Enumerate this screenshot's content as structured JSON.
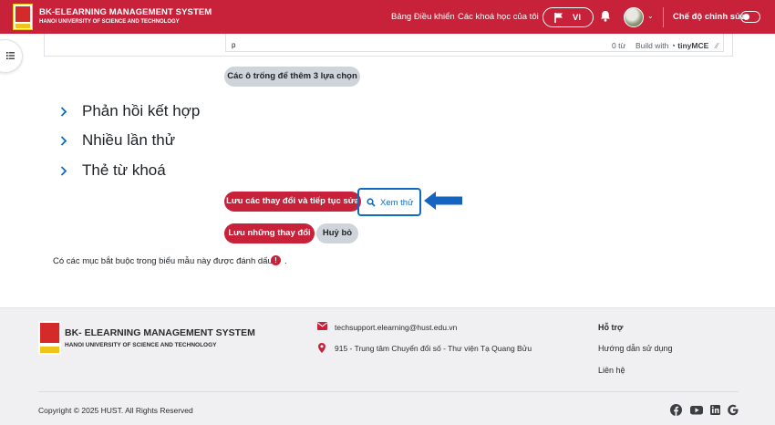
{
  "header": {
    "brand_title": "BK-ELEARNING MANAGEMENT SYSTEM",
    "brand_subtitle": "HANOI UNIVERSITY OF SCIENCE AND TECHNOLOGY",
    "nav_dashboard": "Bảng Điều khiển",
    "nav_my_courses": "Các khoá học của tôi",
    "language": "VI",
    "edit_mode_label": "Chế độ chỉnh sửa",
    "edit_mode_on": false
  },
  "editor": {
    "path": "p",
    "word_count": "0 từ",
    "build_with": "Build with",
    "tinymce": "tinyMCE"
  },
  "form": {
    "add_choices_button": "Các ô trống để thêm 3 lựa chọn",
    "sections": [
      {
        "title": "Phản hồi kết hợp"
      },
      {
        "title": "Nhiều lần thử"
      },
      {
        "title": "Thẻ từ khoá"
      }
    ],
    "save_continue_button": "Lưu các thay đổi và tiếp tục sửa",
    "preview_button": "Xem thử",
    "save_button": "Lưu những thay đổi",
    "cancel_button": "Huỷ bỏ",
    "required_note": "Có các mục bắt buộc trong biểu mẫu này được đánh dấu",
    "required_icon": "!",
    "required_period": "."
  },
  "footer": {
    "brand_title": "BK- ELEARNING MANAGEMENT SYSTEM",
    "brand_subtitle": "HANOI UNIVERSITY OF SCIENCE AND TECHNOLOGY",
    "email": "techsupport.elearning@hust.edu.vn",
    "address": "915 - Trung tâm Chuyển đổi số - Thư viện Tạ Quang Bửu",
    "support_heading": "Hỗ trợ",
    "support_links": [
      "Hướng dẫn sử dụng",
      "Liên hệ"
    ],
    "copyright": "Copyright © 2025 HUST. All Rights Reserved",
    "social": [
      "facebook-icon",
      "youtube-icon",
      "linkedin-icon",
      "google-icon"
    ]
  },
  "colors": {
    "brand_red": "#c8213a",
    "link_blue": "#0f6cbf",
    "annotation_arrow": "#1565c0"
  }
}
